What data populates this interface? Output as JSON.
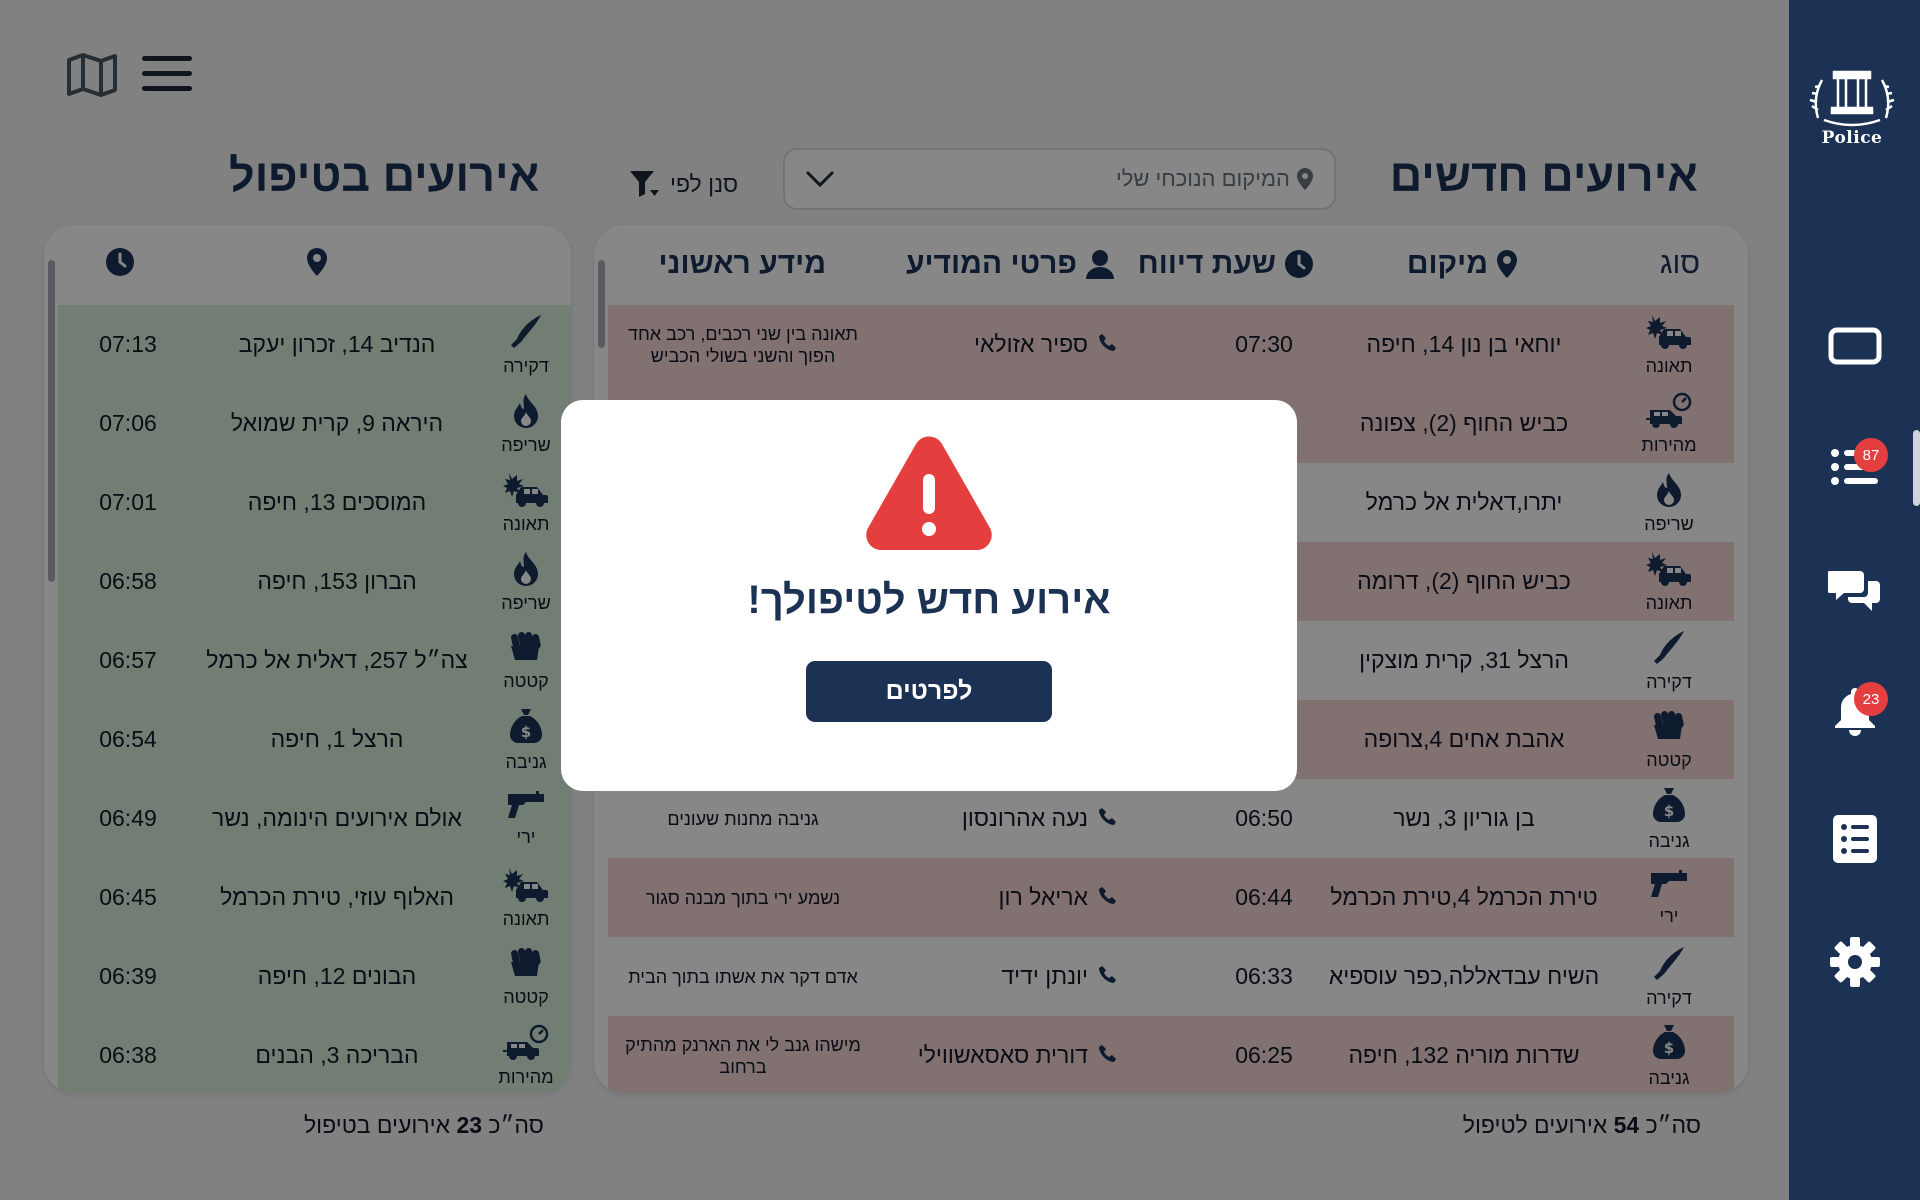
{
  "sidebar": {
    "logo_text": "Police",
    "nav": [
      {
        "icon": "tablet-icon"
      },
      {
        "icon": "list-icon",
        "badge": "87"
      },
      {
        "icon": "chat-icon"
      },
      {
        "icon": "bell-icon",
        "badge": "23"
      },
      {
        "icon": "document-list-icon"
      },
      {
        "icon": "settings-icon"
      }
    ]
  },
  "header": {
    "new_events_title": "אירועים חדשים",
    "handled_events_title": "אירועים בטיפול",
    "location_placeholder": "המיקום הנוכחי שלי",
    "filter_label": "סנן לפי"
  },
  "new_events": {
    "columns": {
      "type": "סוג",
      "location": "מיקום",
      "report_time": "שעת דיווח",
      "reporter": "פרטי המודיע",
      "info": "מידע ראשוני"
    },
    "rows": [
      {
        "type": "תאונה",
        "icon": "crash",
        "location": "יוחאי בן נון 14, חיפה",
        "time": "07:30",
        "reporter": "ספיר אזולאי",
        "info": "תאונה בין שני רכבים, רכב אחד הפוך והשני בשולי הכביש",
        "tint": "red"
      },
      {
        "type": "מהירות",
        "icon": "speed",
        "location": "כביש החוף (2), צפונה",
        "time": "",
        "reporter": "",
        "info": "",
        "tint": "red"
      },
      {
        "type": "שריפה",
        "icon": "fire",
        "location": "יתרו,דאלית אל כרמל",
        "time": "",
        "reporter": "",
        "info": "",
        "tint": "none"
      },
      {
        "type": "תאונה",
        "icon": "crash",
        "location": "כביש החוף (2), דרומה",
        "time": "",
        "reporter": "",
        "info": "",
        "tint": "red"
      },
      {
        "type": "דקירה",
        "icon": "knife",
        "location": "הרצל 31, קרית מוצקין",
        "time": "",
        "reporter": "",
        "info": "",
        "tint": "none"
      },
      {
        "type": "קטטה",
        "icon": "fist",
        "location": "אהבת אחים 4,צרופה",
        "time": "",
        "reporter": "",
        "info": "",
        "tint": "red"
      },
      {
        "type": "גניבה",
        "icon": "moneybag",
        "location": "בן גוריון 3, נשר",
        "time": "06:50",
        "reporter": "נעה אהרונסון",
        "info": "גניבה מחנות שעונים",
        "tint": "none"
      },
      {
        "type": "ירי",
        "icon": "gun",
        "location": "טירת הכרמל 4,טירת הכרמל",
        "time": "06:44",
        "reporter": "אריאל רון",
        "info": "נשמע ירי בתוך מבנה סגור",
        "tint": "red"
      },
      {
        "type": "דקירה",
        "icon": "knife",
        "location": "השיח עבדאללה,כפר עוספיא",
        "time": "06:33",
        "reporter": "יונתן ידיד",
        "info": "אדם דקר את אשתו בתוך הבית",
        "tint": "none"
      },
      {
        "type": "גניבה",
        "icon": "moneybag",
        "location": "שדרות מוריה 132, חיפה",
        "time": "06:25",
        "reporter": "דורית סאסאשווילי",
        "info": "מישהו גנב לי את הארנק מהתיק ברחוב",
        "tint": "red"
      }
    ],
    "total_prefix": "סה״כ",
    "total_count": "54",
    "total_suffix": "אירועים לטיפול"
  },
  "handled_events": {
    "rows": [
      {
        "type": "דקירה",
        "icon": "knife",
        "location": "הנדיב 14, זכרון יעקב",
        "time": "07:13"
      },
      {
        "type": "שריפה",
        "icon": "fire",
        "location": "היראה 9, קרית שמואל",
        "time": "07:06"
      },
      {
        "type": "תאונה",
        "icon": "crash",
        "location": "המוסכים 13, חיפה",
        "time": "07:01"
      },
      {
        "type": "שריפה",
        "icon": "fire",
        "location": "הברון 153, חיפה",
        "time": "06:58"
      },
      {
        "type": "קטטה",
        "icon": "fist",
        "location": "צה״ל 257, דאלית אל כרמל",
        "time": "06:57"
      },
      {
        "type": "גניבה",
        "icon": "moneybag",
        "location": "הרצל 1, חיפה",
        "time": "06:54"
      },
      {
        "type": "ירי",
        "icon": "gun",
        "location": "אולם אירועים הינומה, נשר",
        "time": "06:49"
      },
      {
        "type": "תאונה",
        "icon": "crash",
        "location": "האלוף עוזי, טירת הכרמל",
        "time": "06:45"
      },
      {
        "type": "קטטה",
        "icon": "fist",
        "location": "הבונים 12, חיפה",
        "time": "06:39"
      },
      {
        "type": "מהירות",
        "icon": "speed",
        "location": "הבריכה 3, הבנים",
        "time": "06:38"
      }
    ],
    "total_prefix": "סה״כ",
    "total_count": "23",
    "total_suffix": "אירועים בטיפול"
  },
  "modal": {
    "message": "אירוע חדש לטיפולך!",
    "button_label": "לפרטים"
  },
  "colors": {
    "navy": "#1c3255",
    "row_red": "#f3d7d6",
    "row_green": "#d8efdc",
    "alert_red": "#e53e3e"
  }
}
